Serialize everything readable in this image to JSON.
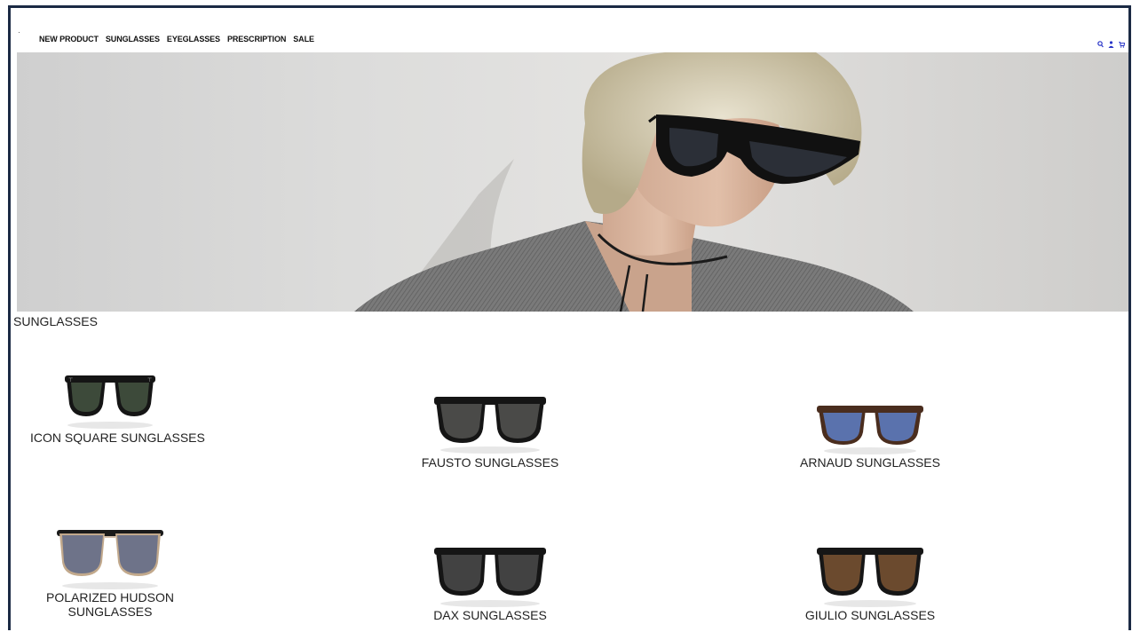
{
  "nav": {
    "links": [
      "NEW PRODUCT",
      "SUNGLASSES",
      "EYEGLASSES",
      "PRESCRIPTION",
      "SALE"
    ],
    "icons": [
      "search-icon",
      "user-icon",
      "cart-icon"
    ],
    "accent": "#2a36c8"
  },
  "section": {
    "title": "SUNGLASSES"
  },
  "products": [
    {
      "name": "ICON SQUARE SUNGLASSES",
      "lens": "#3d4a3a",
      "frame": "#151515"
    },
    {
      "name": "FAUSTO SUNGLASSES",
      "lens": "#4a4a48",
      "frame": "#151515"
    },
    {
      "name": "ARNAUD SUNGLASSES",
      "lens": "#5a72ad",
      "frame": "#4a2d1e"
    },
    {
      "name": "POLARIZED HUDSON SUNGLASSES",
      "lens": "#6e7389",
      "frame": "#1a1a1a"
    },
    {
      "name": "DAX SUNGLASSES",
      "lens": "#424242",
      "frame": "#151515"
    },
    {
      "name": "GIULIO SUNGLASSES",
      "lens": "#6b4a2e",
      "frame": "#161616"
    }
  ]
}
